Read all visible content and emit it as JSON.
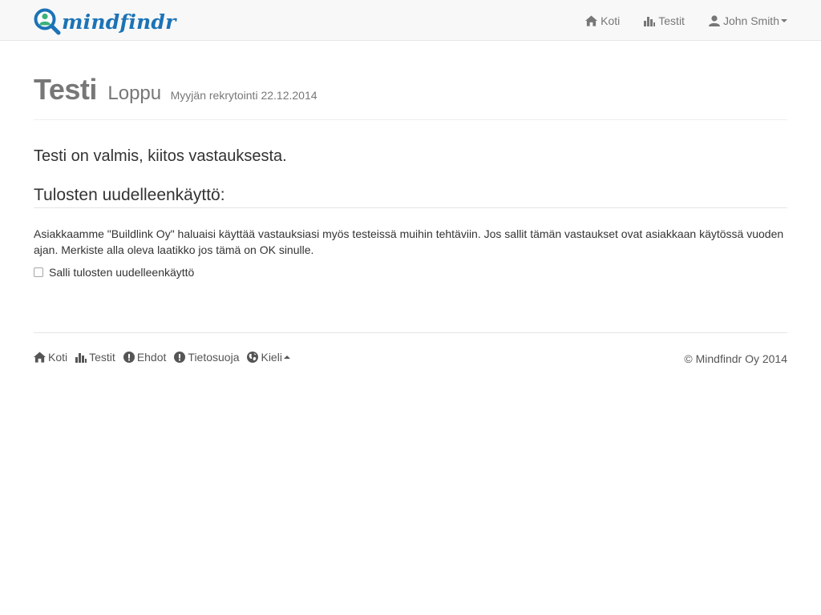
{
  "navbar": {
    "brand": "mindfindr",
    "brand_icon": "magnifier-person-icon",
    "links": [
      {
        "label": "Koti",
        "icon": "home-icon"
      },
      {
        "label": "Testit",
        "icon": "stats-icon"
      },
      {
        "label": "John Smith",
        "icon": "user-icon"
      }
    ]
  },
  "header": {
    "title": "Testi",
    "subtitle": "Loppu",
    "meta": "Myyjän rekrytointi 22.12.2014"
  },
  "main": {
    "lead": "Testi on valmis, kiitos vastauksesta.",
    "section_title": "Tulosten uudelleenkäyttö:",
    "paragraph": "Asiakkaamme \"Buildlink Oy\" haluaisi käyttää vastauksiasi myös testeissä muihin tehtäviin. Jos sallit tämän vastaukset ovat asiakkaan käytössä vuoden ajan. Merkiste alla oleva laatikko jos tämä on OK sinulle.",
    "checkbox_label": "Salli tulosten uudelleenkäyttö",
    "checkbox_checked": false
  },
  "footer": {
    "links": [
      {
        "label": "Koti",
        "icon": "home-icon"
      },
      {
        "label": "Testit",
        "icon": "stats-icon"
      },
      {
        "label": "Ehdot",
        "icon": "exclamation-circle-icon"
      },
      {
        "label": "Tietosuoja",
        "icon": "exclamation-circle-icon"
      },
      {
        "label": "Kieli",
        "icon": "globe-icon"
      }
    ],
    "copyright": "© Mindfindr Oy 2014"
  },
  "colors": {
    "brand_blue": "#1c73b6",
    "brand_green": "#3ab27a",
    "navbar_bg": "#f8f8f8",
    "muted_text": "#777777"
  }
}
